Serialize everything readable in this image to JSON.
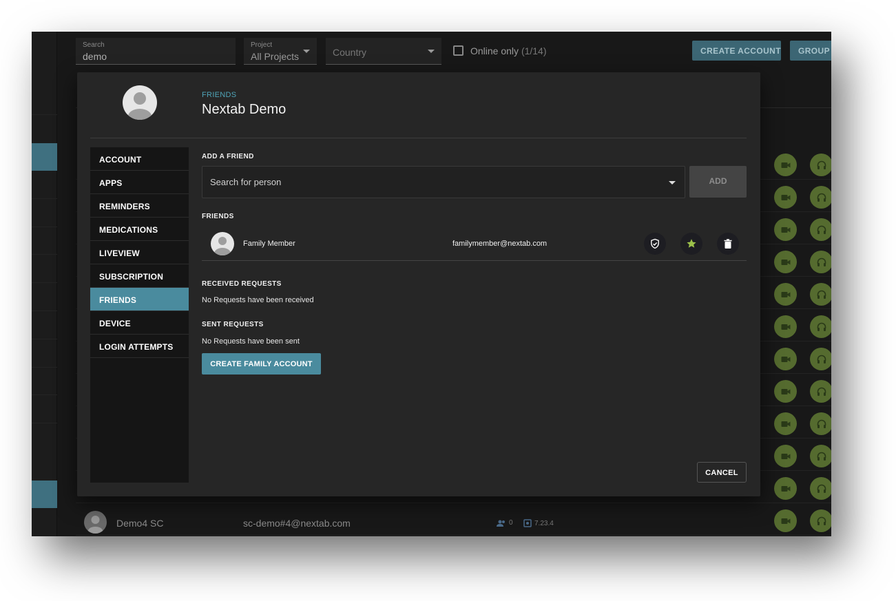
{
  "toolbar": {
    "search_label": "Search",
    "search_value": "demo",
    "project_label": "Project",
    "project_value": "All Projects",
    "country_placeholder": "Country",
    "online_label": "Online only",
    "online_count": "(1/14)",
    "create_account": "CREATE ACCOUNT",
    "group_account": "GROUP A"
  },
  "background_row": {
    "name": "Demo4 SC",
    "email": "sc-demo#4@nextab.com",
    "friends_count": "0",
    "version": "7.23.4"
  },
  "modal": {
    "section": "FRIENDS",
    "user_name": "Nextab Demo",
    "nav": [
      {
        "label": "ACCOUNT"
      },
      {
        "label": "APPS"
      },
      {
        "label": "REMINDERS"
      },
      {
        "label": "MEDICATIONS"
      },
      {
        "label": "LIVEVIEW"
      },
      {
        "label": "SUBSCRIPTION"
      },
      {
        "label": "FRIENDS",
        "active": true
      },
      {
        "label": "DEVICE"
      },
      {
        "label": "LOGIN ATTEMPTS"
      }
    ],
    "add_friend_heading": "ADD A FRIEND",
    "search_placeholder": "Search for person",
    "add_button": "ADD",
    "friends_heading": "FRIENDS",
    "friends": [
      {
        "name": "Family Member",
        "email": "familymember@nextab.com"
      }
    ],
    "received_heading": "RECEIVED REQUESTS",
    "received_empty": "No Requests have been received",
    "sent_heading": "SENT REQUESTS",
    "sent_empty": "No Requests have been sent",
    "create_family_button": "CREATE FAMILY ACCOUNT",
    "cancel_button": "CANCEL"
  },
  "colors": {
    "accent": "#4a8b9e",
    "accent_text": "#4fa4b8",
    "action_green": "#556b2f",
    "star": "#9cc14a"
  }
}
